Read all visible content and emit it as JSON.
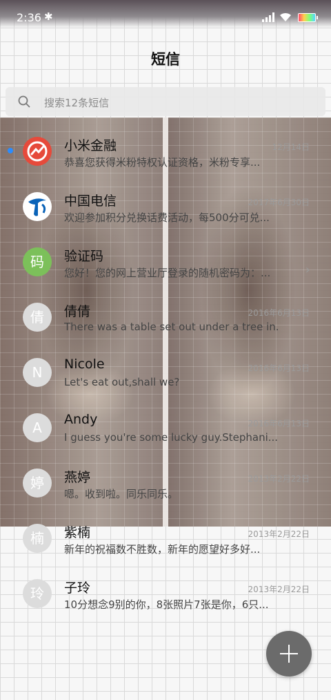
{
  "status": {
    "time": "2:36",
    "bluetooth_glyph": "✱"
  },
  "header": {
    "title": "短信"
  },
  "search": {
    "placeholder": "搜索12条短信"
  },
  "messages": [
    {
      "sender": "小米金融",
      "date": "12月14日",
      "preview": "恭喜您获得米粉特权认证资格，米粉专享...",
      "avatar_text": "",
      "avatar_icon": "mi-finance-logo-icon",
      "unread": true
    },
    {
      "sender": "中国电信",
      "date": "2017年6月30日",
      "preview": "欢迎参加积分兑换话费活动，每500分可兑...",
      "avatar_text": "",
      "avatar_icon": "china-telecom-logo-icon"
    },
    {
      "sender": "验证码",
      "date": "",
      "preview": "您好！您的网上营业厅登录的随机密码为：...",
      "avatar_text": "码",
      "chevron": "›"
    },
    {
      "sender": "倩倩",
      "date": "2016年6月13日",
      "preview": "There was a table set out under a tree in...",
      "avatar_text": "倩"
    },
    {
      "sender": "Nicole",
      "date": "2016年6月13日",
      "preview": "Let's eat out,shall we?",
      "avatar_text": "N"
    },
    {
      "sender": "Andy",
      "date": "2016年6月13日",
      "preview": "I guess you're some lucky guy.Stephani...",
      "avatar_text": "A"
    },
    {
      "sender": "燕婷",
      "date": "2013年2月22日",
      "preview": "嗯。收到啦。同乐同乐。",
      "avatar_text": "婷"
    },
    {
      "sender": "紫楠",
      "date": "2013年2月22日",
      "preview": "新年的祝福数不胜数，新年的愿望好多好...",
      "avatar_text": "楠"
    },
    {
      "sender": "子玲",
      "date": "2013年2月22日",
      "preview": "10分想念9别的你，8张照片7张是你，6只...",
      "avatar_text": "玲"
    }
  ],
  "colors": {
    "unread_dot": "#2a8cff",
    "fab": "#6b6b6b",
    "mi_finance": "#e64a3b",
    "verify_avatar": "#7cc05a"
  }
}
